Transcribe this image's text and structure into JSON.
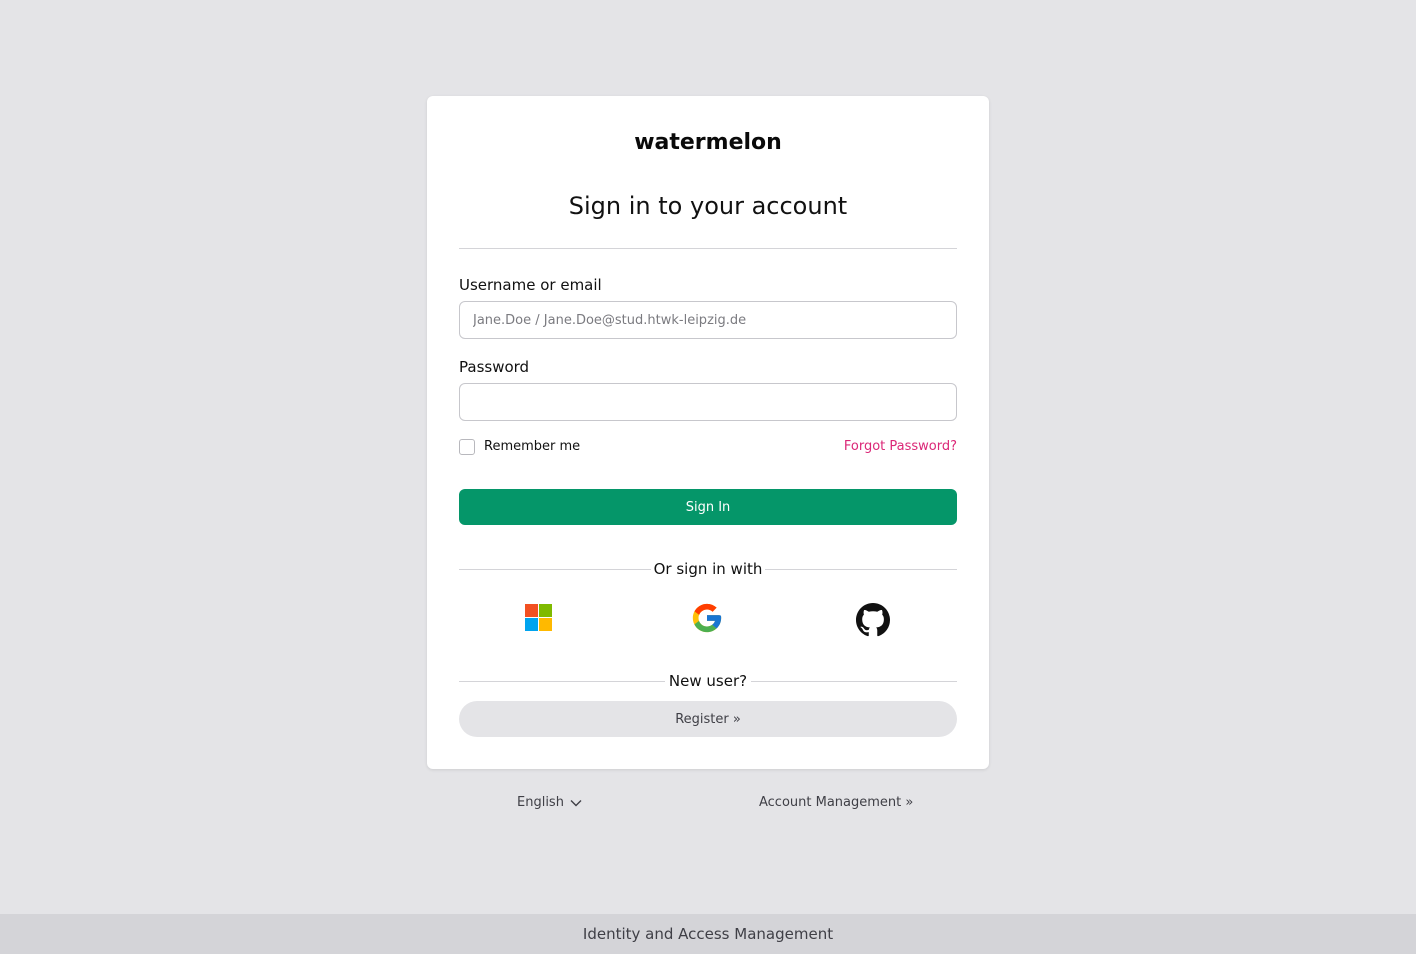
{
  "brand": {
    "logo_text": "watermelon"
  },
  "login": {
    "title": "Sign in to your account",
    "username_label": "Username or email",
    "username_placeholder": "Jane.Doe / Jane.Doe@stud.htwk-leipzig.de",
    "password_label": "Password",
    "remember_label": "Remember me",
    "forgot_link": "Forgot Password?",
    "submit_label": "Sign In"
  },
  "social": {
    "heading": "Or sign in with",
    "providers": [
      "microsoft-icon",
      "google-icon",
      "github-icon"
    ]
  },
  "register": {
    "heading": "New user?",
    "button_label": "Register »"
  },
  "links": {
    "language": "English",
    "account_management": "Account Management »"
  },
  "footer": {
    "text": "Identity and Access Management"
  },
  "colors": {
    "background": "#e4e4e7",
    "primary": "#059669",
    "link": "#db2777",
    "footer_bg": "#d4d4d8"
  }
}
